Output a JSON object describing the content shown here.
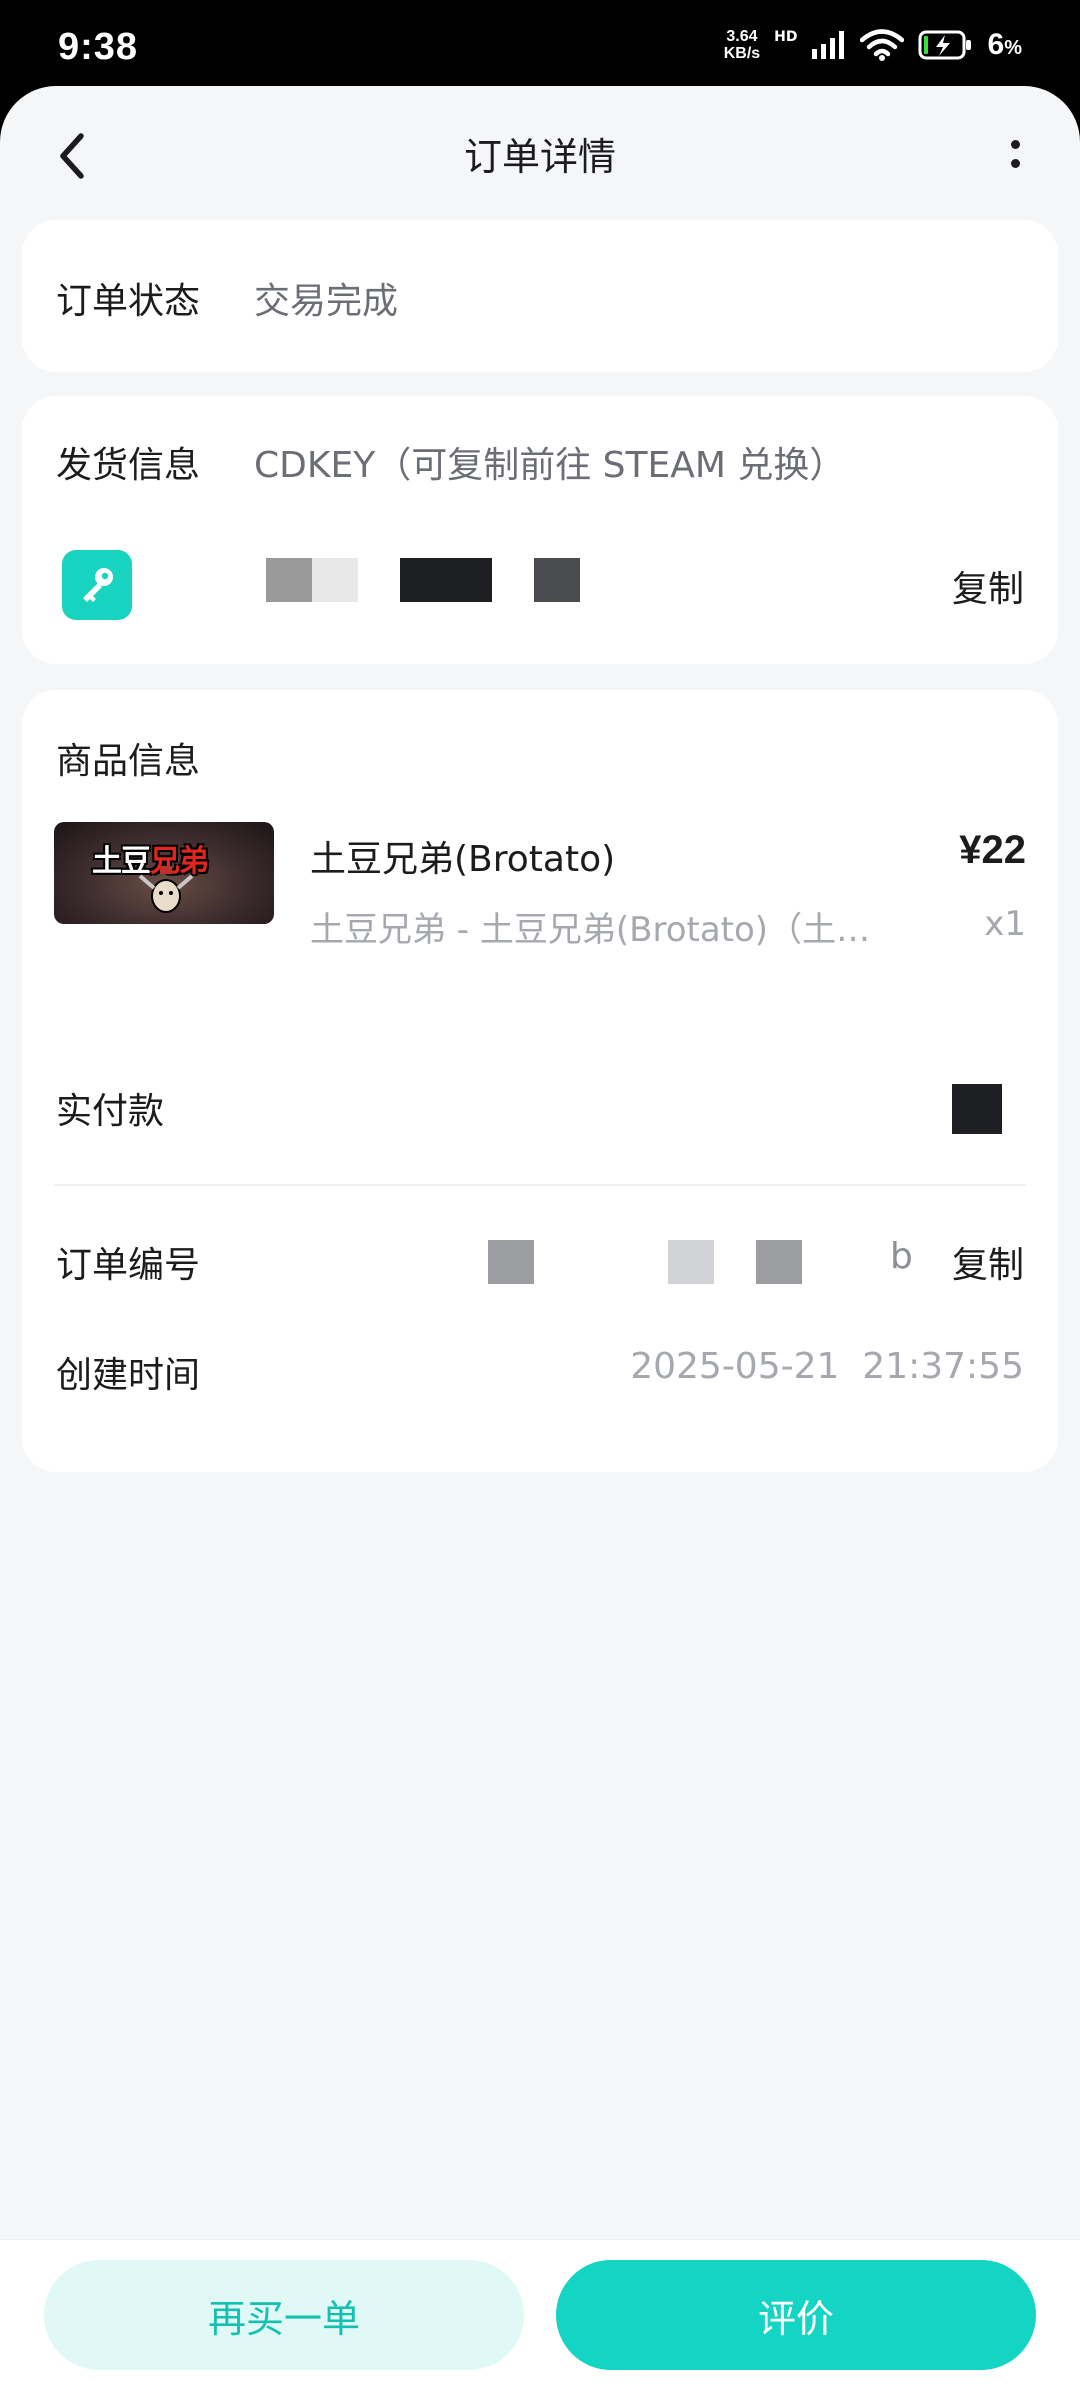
{
  "status_bar": {
    "time": "9:38",
    "net_speed_value": "3.64",
    "net_speed_unit": "KB/s",
    "hd": "HD",
    "battery_percent": "6",
    "battery_percent_sign": "%"
  },
  "nav": {
    "title": "订单详情"
  },
  "order_status": {
    "label": "订单状态",
    "value": "交易完成"
  },
  "shipping": {
    "label": "发货信息",
    "value": "CDKEY（可复制前往 STEAM 兑换）",
    "copy_label": "复制"
  },
  "goods": {
    "section_title": "商品信息",
    "thumbnail_text_a": "土豆",
    "thumbnail_text_b": "兄弟",
    "product_name": "土豆兄弟(Brotato)",
    "price": "¥22",
    "product_sub": "土豆兄弟 - 土豆兄弟(Brotato)（土…",
    "quantity": "x1",
    "paid_label": "实付款",
    "order_no_label": "订单编号",
    "order_no_tail": "b",
    "order_no_copy": "复制",
    "created_label": "创建时间",
    "created_value": "2025-05-21  21:37:55"
  },
  "bottom": {
    "rebuy_label": "再买一单",
    "review_label": "评价"
  },
  "colors": {
    "accent": "#14d4c4",
    "accent_light": "#e0f8f6",
    "background": "#f5f6f8"
  }
}
